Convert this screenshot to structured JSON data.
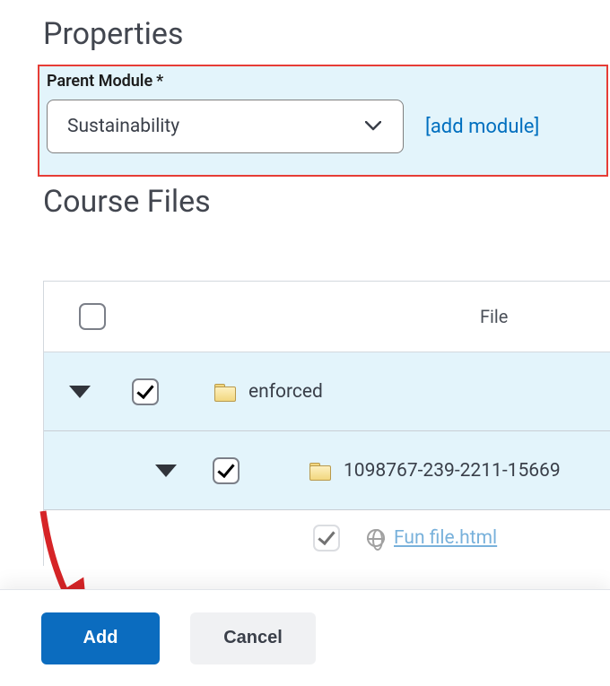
{
  "headings": {
    "properties": "Properties",
    "course_files": "Course Files"
  },
  "parent_module": {
    "label": "Parent Module",
    "required_mark": "*",
    "value": "Sustainability",
    "add_link": "[add module]"
  },
  "table": {
    "file_header": "File",
    "rows": [
      {
        "name": "enforced",
        "checked": true
      },
      {
        "name": "1098767-239-2211-15669",
        "checked": true
      },
      {
        "name": "Fun file.html",
        "checked": true
      }
    ]
  },
  "buttons": {
    "add": "Add",
    "cancel": "Cancel"
  }
}
